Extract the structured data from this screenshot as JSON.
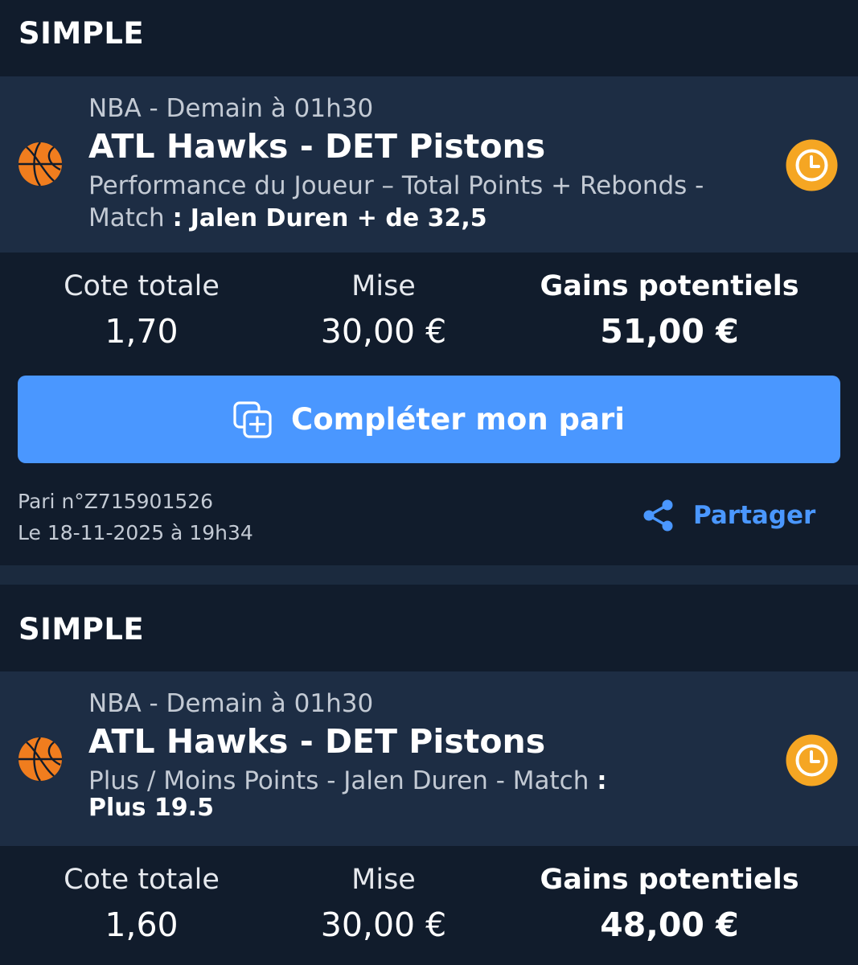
{
  "colors": {
    "background": "#111c2c",
    "event_background": "#1d2d44",
    "accent_blue": "#4a97ff",
    "clock_orange": "#f5a623",
    "ball_orange": "#f07d1e"
  },
  "bets": [
    {
      "type": "SIMPLE",
      "league_time": "NBA - Demain à 01h30",
      "match": "ATL Hawks - DET Pistons",
      "market": "Performance du Joueur – Total Points + Rebonds - Match",
      "pick": "Jalen Duren + de 32,5",
      "odds_label": "Cote totale",
      "odds_value": "1,70",
      "stake_label": "Mise",
      "stake_value": "30,00 €",
      "gains_label": "Gains potentiels",
      "gains_value": "51,00 €",
      "complete_button": "Compléter mon pari",
      "bet_number": "Pari n°Z715901526",
      "bet_date": "Le 18-11-2025 à 19h34",
      "share_label": "Partager",
      "sport_icon": "basketball-icon",
      "status_icon": "clock-icon"
    },
    {
      "type": "SIMPLE",
      "league_time": "NBA - Demain à 01h30",
      "match": "ATL Hawks - DET Pistons",
      "market": "Plus / Moins Points - Jalen Duren - Match",
      "pick": "Plus 19.5",
      "odds_label": "Cote totale",
      "odds_value": "1,60",
      "stake_label": "Mise",
      "stake_value": "30,00 €",
      "gains_label": "Gains potentiels",
      "gains_value": "48,00 €",
      "sport_icon": "basketball-icon",
      "status_icon": "clock-icon"
    }
  ]
}
